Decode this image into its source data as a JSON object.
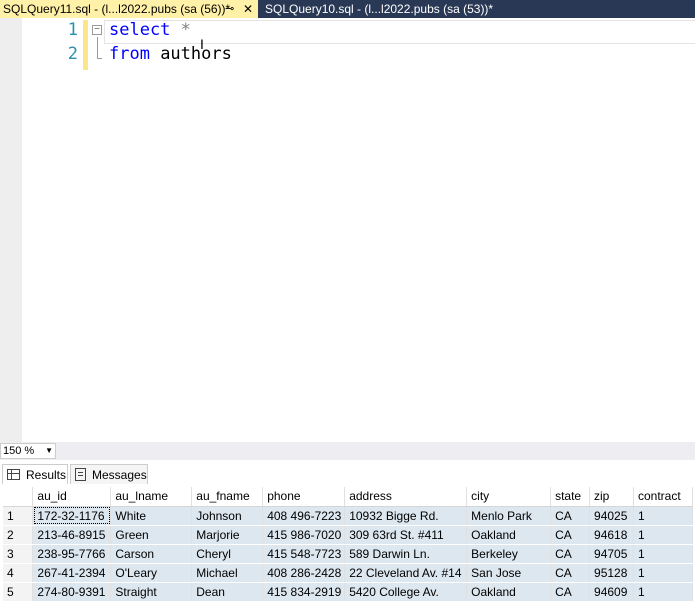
{
  "tabs": [
    {
      "title": "SQLQuery11.sql - (l...l2022.pubs (sa (56))*",
      "pin": "⊸",
      "close": "✕"
    },
    {
      "title": "SQLQuery10.sql - (l...l2022.pubs (sa (53))*"
    }
  ],
  "editor": {
    "line_numbers": [
      "1",
      "2"
    ],
    "line1": {
      "keyword": "select",
      "rest": " *"
    },
    "line2": {
      "keyword": "from",
      "rest": " authors"
    }
  },
  "zoom": {
    "value": "150 %"
  },
  "result_tabs": {
    "results": "Results",
    "messages": "Messages"
  },
  "grid": {
    "columns": [
      "au_id",
      "au_lname",
      "au_fname",
      "phone",
      "address",
      "city",
      "state",
      "zip",
      "contract"
    ],
    "rows": [
      [
        "1",
        "172-32-1176",
        "White",
        "Johnson",
        "408 496-7223",
        "10932 Bigge Rd.",
        "Menlo Park",
        "CA",
        "94025",
        "1"
      ],
      [
        "2",
        "213-46-8915",
        "Green",
        "Marjorie",
        "415 986-7020",
        "309 63rd St. #411",
        "Oakland",
        "CA",
        "94618",
        "1"
      ],
      [
        "3",
        "238-95-7766",
        "Carson",
        "Cheryl",
        "415 548-7723",
        "589 Darwin Ln.",
        "Berkeley",
        "CA",
        "94705",
        "1"
      ],
      [
        "4",
        "267-41-2394",
        "O'Leary",
        "Michael",
        "408 286-2428",
        "22 Cleveland Av. #14",
        "San Jose",
        "CA",
        "95128",
        "1"
      ],
      [
        "5",
        "274-80-9391",
        "Straight",
        "Dean",
        "415 834-2919",
        "5420 College Av.",
        "Oakland",
        "CA",
        "94609",
        "1"
      ]
    ]
  },
  "colors": {
    "tab_active": "#fff1a8",
    "tab_bar": "#293955",
    "keyword": "#0000ff",
    "line_number": "#2b91af"
  }
}
